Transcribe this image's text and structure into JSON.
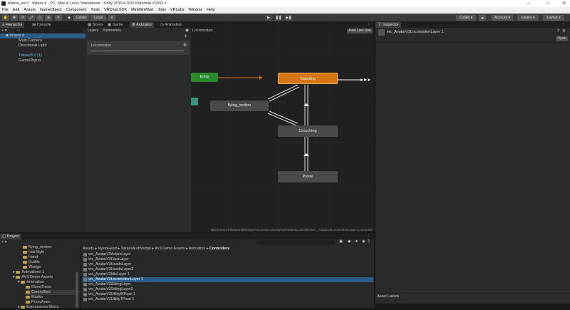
{
  "window": {
    "title": "toliass_ver7 - toliass 4 - PC, Mac & Linux Standalone - Unity 2019.4.31f1 Personal <DX11>",
    "minimize": "─",
    "maximize": "□",
    "close": "✕"
  },
  "menu": [
    "File",
    "Edit",
    "Assets",
    "GameObject",
    "Component",
    "Tools",
    "VRChat SDK",
    "MiniMiniMart",
    "Jobs",
    "VRLabs",
    "Window",
    "Help"
  ],
  "toolbar": {
    "center": "Center",
    "local": "Local",
    "play": "▶",
    "pause": "❚❚",
    "step": "▶❚",
    "collab": "Collab ▾",
    "account": "Account ▾",
    "layers": "Layers ▾",
    "layout": "Layout ▾"
  },
  "hierarchy": {
    "tab": "Hierarchy",
    "console_tab": "Console",
    "add": "+ ▾",
    "search_placeholder": "All",
    "root": "toliass 4",
    "items": [
      "Main Camera",
      "Directional Light",
      "",
      "Toliass3.1 (1)",
      "GameObject"
    ]
  },
  "animator": {
    "tabs": [
      "Scene",
      "Game",
      "Animator",
      "Animation"
    ],
    "subtabs": [
      "Layers",
      "Parameters"
    ],
    "layer": "Locomotion",
    "breadcrumb": "Locomotion",
    "auto_live": "Auto Live Link",
    "path": "NylonHeart/ToliassAndWedge/AV3 Demo Assets/Animation/Controllers/vrc_AvatarV3LocomotionLayer 1.controller",
    "states": {
      "entry": "Entry",
      "standing": "Standing",
      "flying": "flying_motion",
      "crouching": "Crouching",
      "prone": "Prone"
    }
  },
  "inspector": {
    "tab": "Inspector",
    "asset": "vrc_AvatarV3LocomotionLayer 1",
    "open": "Open",
    "asset_labels": "Asset Labels"
  },
  "project": {
    "tab": "Project",
    "add": "+ ▾",
    "badge": "2",
    "tree": [
      {
        "label": "flying_motion",
        "indent": 4
      },
      {
        "label": "HairStyle",
        "indent": 4
      },
      {
        "label": "Hand",
        "indent": 4
      },
      {
        "label": "Outfits",
        "indent": 4
      },
      {
        "label": "Wedge",
        "indent": 4
      },
      {
        "label": "Animations 1",
        "indent": 2
      },
      {
        "label": "AV3 Demo Assets",
        "indent": 2
      },
      {
        "label": "Animation",
        "indent": 3
      },
      {
        "label": "BlendTrees",
        "indent": 4
      },
      {
        "label": "Controllers",
        "indent": 4
      },
      {
        "label": "Masks",
        "indent": 4
      },
      {
        "label": "ProxyAnim",
        "indent": 4
      },
      {
        "label": "Expressions Menu",
        "indent": 3
      }
    ],
    "breadcrumb": [
      "Assets",
      "NylonHeart",
      "ToliassAndWedge",
      "AV3 Demo Assets",
      "Animation",
      "Controllers"
    ],
    "files": [
      "vrc_AvatarV3ActionLayer",
      "vrc_AvatarV3FaceLayer",
      "vrc_AvatarV3HandsLayer",
      "vrc_AvatarV3HandsLayer2",
      "vrc_AvatarV3IdleLayer 1",
      "vrc_AvatarV3LocomotionLayer 1",
      "vrc_AvatarV3SittingLayer",
      "vrc_AvatarV3SittingLayer2",
      "vrc_AvatarV3UtilityIKPose 1",
      "vrc_AvatarV3UtilityTPose 1"
    ],
    "selected_index": 5
  },
  "colors": {
    "entry": "#2b8a2b",
    "standing": "#d47512",
    "state": "#4a4a4a",
    "selection": "#2c5d87",
    "accent": "#6fc6e6"
  }
}
